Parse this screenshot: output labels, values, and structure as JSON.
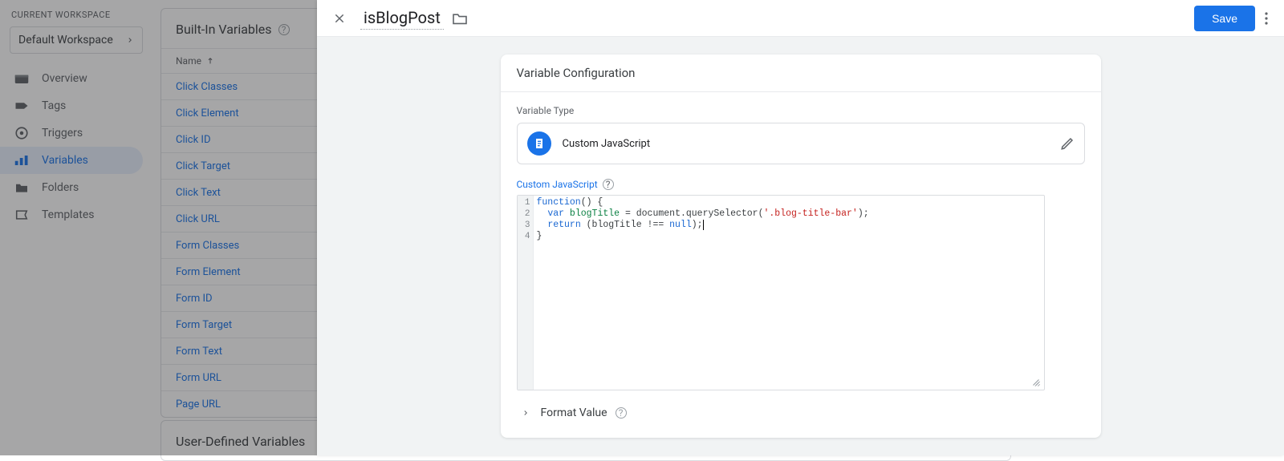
{
  "sidebar": {
    "heading": "CURRENT WORKSPACE",
    "workspace": "Default Workspace",
    "items": [
      {
        "label": "Overview"
      },
      {
        "label": "Tags"
      },
      {
        "label": "Triggers"
      },
      {
        "label": "Variables"
      },
      {
        "label": "Folders"
      },
      {
        "label": "Templates"
      }
    ]
  },
  "list": {
    "section_title": "Built-In Variables",
    "column": "Name",
    "vars": [
      "Click Classes",
      "Click Element",
      "Click ID",
      "Click Target",
      "Click Text",
      "Click URL",
      "Form Classes",
      "Form Element",
      "Form ID",
      "Form Target",
      "Form Text",
      "Form URL",
      "Page URL"
    ],
    "user_section_title": "User-Defined Variables"
  },
  "editor": {
    "variable_name": "isBlogPost",
    "save": "Save",
    "card_title": "Variable Configuration",
    "type_label": "Variable Type",
    "type_name": "Custom JavaScript",
    "code_label": "Custom JavaScript",
    "code": {
      "line1": {
        "kw1": "function",
        "rest": "() {"
      },
      "line2": {
        "pad": "  ",
        "kw": "var",
        "id": " blogTitle ",
        "eq": "= document.querySelector(",
        "str": "'.blog-title-bar'",
        "close": ");"
      },
      "line3": {
        "pad": "  ",
        "kw": "return",
        "rest": " (blogTitle !== ",
        "kw2": "null",
        "close": ");"
      },
      "line4": "}"
    },
    "format_label": "Format Value"
  }
}
